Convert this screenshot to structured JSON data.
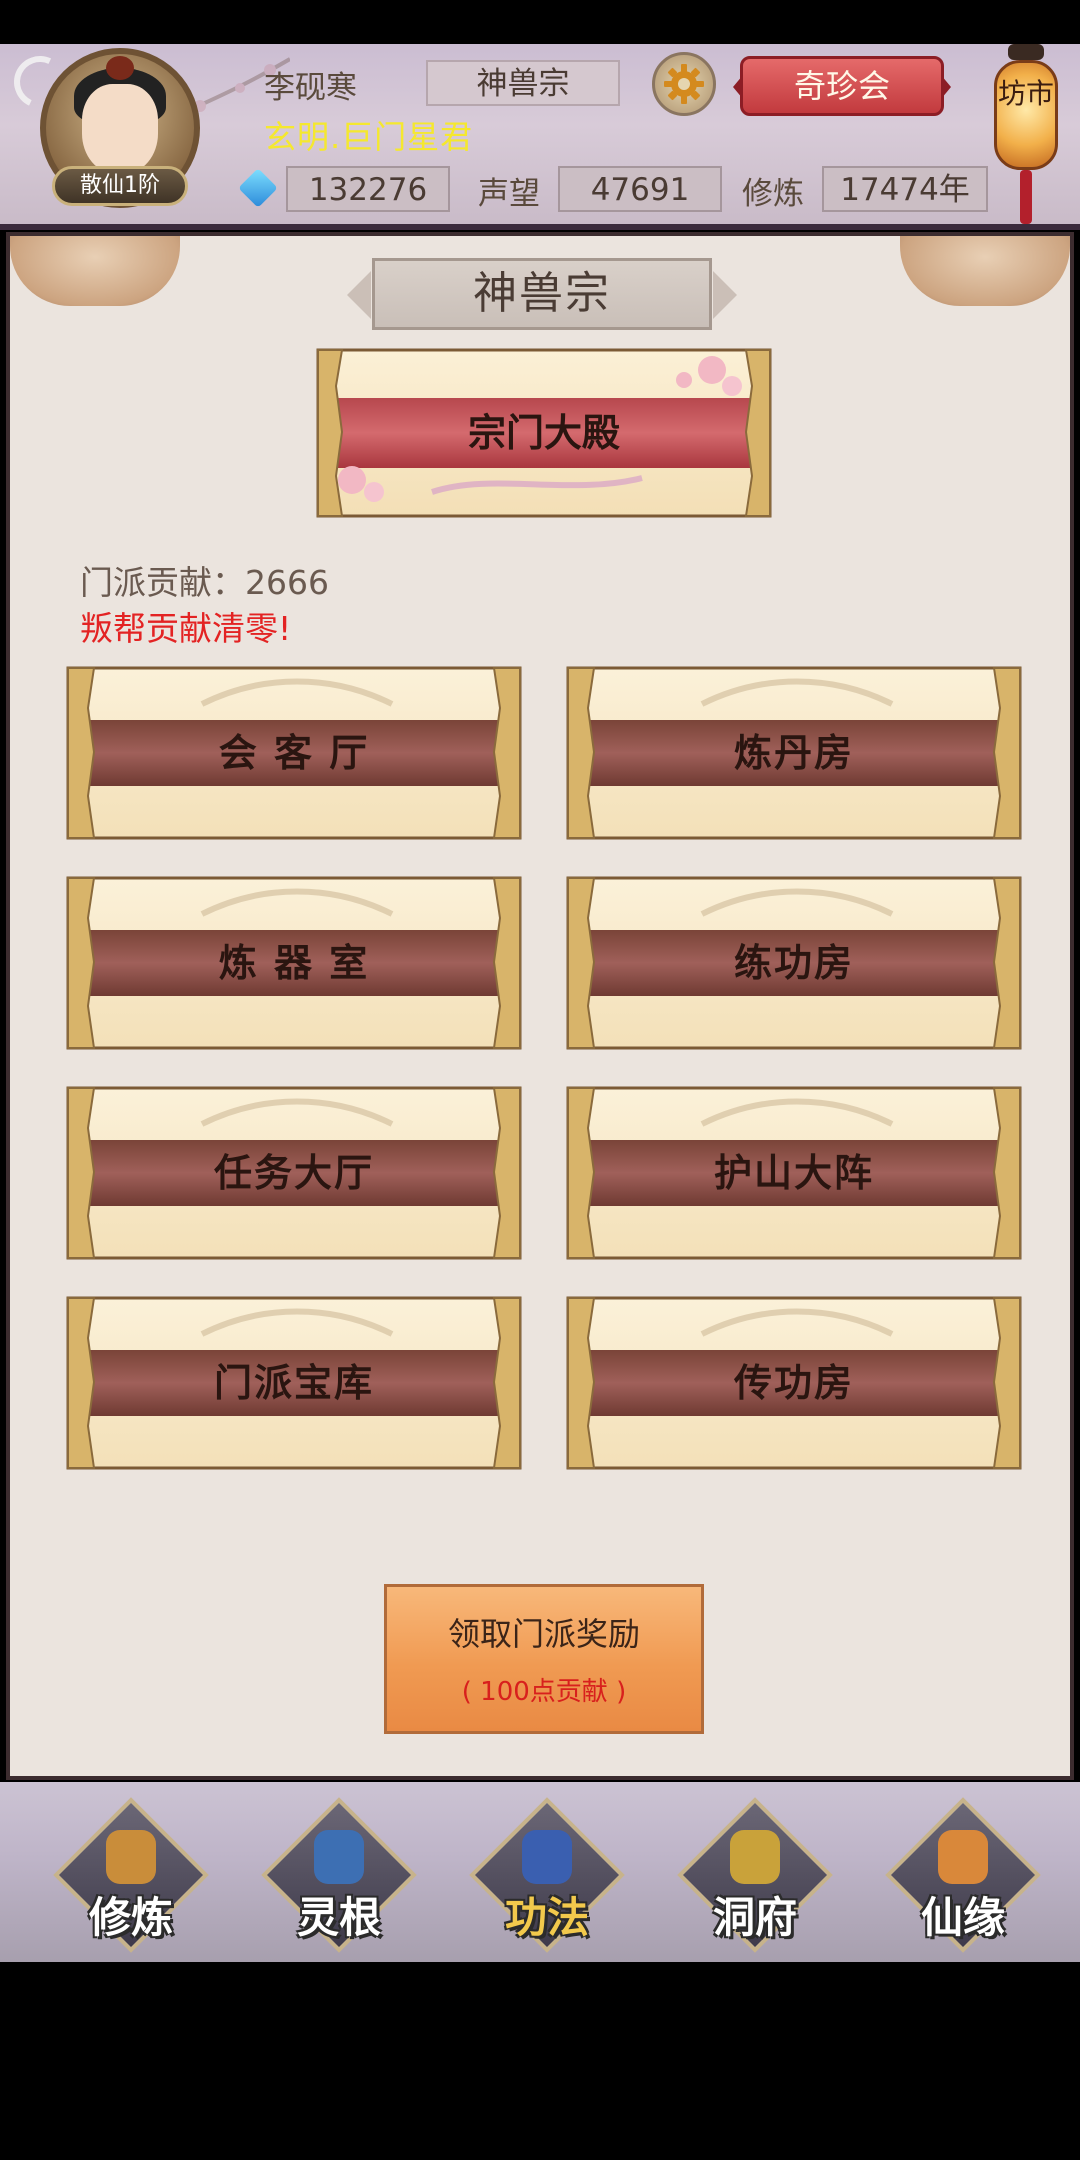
{
  "header": {
    "player_name": "李砚寒",
    "sect_name": "神兽宗",
    "title_line": "玄明.巨门星君",
    "rank_badge": "散仙1阶",
    "spirit_stones": "132276",
    "prestige_label": "声望",
    "prestige_value": "47691",
    "cultivation_label": "修炼",
    "cultivation_value": "17474年",
    "treasure_button": "奇珍会",
    "market_label": "坊市",
    "icons": {
      "settings": "gear-icon",
      "currency": "gem-icon"
    }
  },
  "panel": {
    "sect_title": "神兽宗",
    "hall_button": "宗门大殿",
    "contribution_text": "门派贡献：2666",
    "warning_text": "叛帮贡献清零!",
    "buildings": [
      {
        "label": "会 客 厅"
      },
      {
        "label": "炼丹房"
      },
      {
        "label": "炼 器 室"
      },
      {
        "label": "练功房"
      },
      {
        "label": "任务大厅"
      },
      {
        "label": "护山大阵"
      },
      {
        "label": "门派宝库"
      },
      {
        "label": "传功房"
      }
    ],
    "reward": {
      "title": "领取门派奖励",
      "subtitle": "( 100点贡献 )"
    }
  },
  "bottom_nav": {
    "items": [
      {
        "label": "修炼",
        "icon": "monk-icon"
      },
      {
        "label": "灵根",
        "icon": "sword-icon"
      },
      {
        "label": "功法",
        "icon": "book-icon",
        "active": true
      },
      {
        "label": "洞府",
        "icon": "pagoda-icon"
      },
      {
        "label": "仙缘",
        "icon": "gourd-icon"
      }
    ]
  },
  "colors": {
    "accent_red": "#c23a3e",
    "warning_red": "#e32323",
    "title_yellow": "#f5e82e",
    "reward_orange": "#f09a52",
    "active_nav": "#f2c94c"
  }
}
